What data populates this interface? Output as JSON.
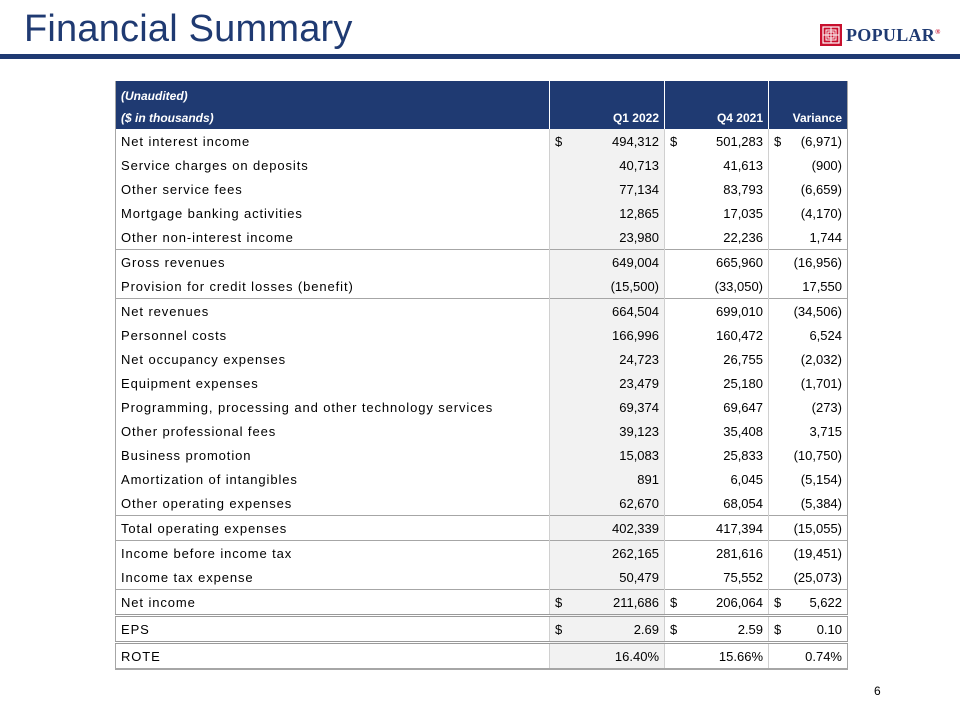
{
  "slide": {
    "title": "Financial Summary",
    "page_number": "6",
    "logo_text": "POPULAR",
    "logo_mark": "®",
    "brand_color": "#1f3a72",
    "accent_color": "#c8102e"
  },
  "table": {
    "header_line1": "(Unaudited)",
    "header_line2": "($ in thousands)",
    "col_q1": "Q1 2022",
    "col_q4": "Q4 2021",
    "col_var": "Variance",
    "rows": [
      {
        "label": "Net interest income",
        "q1": "494,312",
        "q4": "501,283",
        "var": "(6,971)",
        "dollar": true
      },
      {
        "label": "Service charges on deposits",
        "q1": "40,713",
        "q4": "41,613",
        "var": "(900)"
      },
      {
        "label": "Other service fees",
        "q1": "77,134",
        "q4": "83,793",
        "var": "(6,659)"
      },
      {
        "label": "Mortgage banking activities",
        "q1": "12,865",
        "q4": "17,035",
        "var": "(4,170)"
      },
      {
        "label": "Other non-interest income",
        "q1": "23,980",
        "q4": "22,236",
        "var": "1,744"
      },
      {
        "label": "Gross revenues",
        "q1": "649,004",
        "q4": "665,960",
        "var": "(16,956)",
        "rule": "top"
      },
      {
        "label": "Provision for credit losses (benefit)",
        "q1": "(15,500)",
        "q4": "(33,050)",
        "var": "17,550"
      },
      {
        "label": "Net revenues",
        "q1": "664,504",
        "q4": "699,010",
        "var": "(34,506)",
        "rule": "top"
      },
      {
        "label": "Personnel costs",
        "q1": "166,996",
        "q4": "160,472",
        "var": "6,524"
      },
      {
        "label": "Net occupancy expenses",
        "q1": "24,723",
        "q4": "26,755",
        "var": "(2,032)"
      },
      {
        "label": "Equipment expenses",
        "q1": "23,479",
        "q4": "25,180",
        "var": "(1,701)"
      },
      {
        "label": "Programming, processing and other technology services",
        "q1": "69,374",
        "q4": "69,647",
        "var": "(273)"
      },
      {
        "label": "Other professional fees",
        "q1": "39,123",
        "q4": "35,408",
        "var": "3,715"
      },
      {
        "label": "Business promotion",
        "q1": "15,083",
        "q4": "25,833",
        "var": "(10,750)"
      },
      {
        "label": "Amortization of intangibles",
        "q1": "891",
        "q4": "6,045",
        "var": "(5,154)"
      },
      {
        "label": "Other operating expenses",
        "q1": "62,670",
        "q4": "68,054",
        "var": "(5,384)"
      },
      {
        "label": "Total operating expenses",
        "q1": "402,339",
        "q4": "417,394",
        "var": "(15,055)",
        "rule": "top"
      },
      {
        "label": "Income before income tax",
        "q1": "262,165",
        "q4": "281,616",
        "var": "(19,451)",
        "rule": "top"
      },
      {
        "label": "Income tax expense",
        "q1": "50,479",
        "q4": "75,552",
        "var": "(25,073)"
      },
      {
        "label": "Net income",
        "q1": "211,686",
        "q4": "206,064",
        "var": "5,622",
        "dollar": true,
        "rule": "top"
      },
      {
        "label": "EPS",
        "q1": "2.69",
        "q4": "2.59",
        "var": "0.10",
        "dollar": true,
        "rule": "double"
      },
      {
        "label": "ROTE",
        "q1": "16.40%",
        "q4": "15.66%",
        "var": "0.74%",
        "rule": "double",
        "last": true
      }
    ],
    "currency_symbol": "$"
  }
}
